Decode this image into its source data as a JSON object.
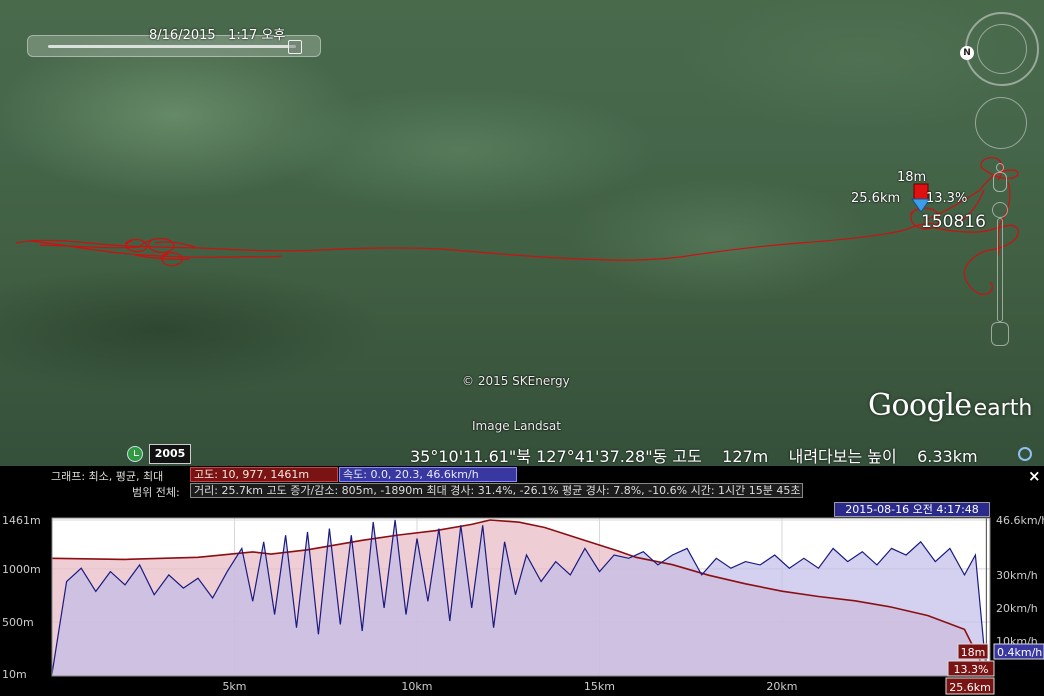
{
  "map": {
    "time_slider_label": "8/16/2015   1:17 오후",
    "tour_label": {
      "altitude": "18m",
      "distance": "25.6km",
      "grade": "13.3%",
      "name": "150816"
    },
    "north_button": "N",
    "copyright": "© 2015 SKEnergy",
    "imagery": "Image Landsat",
    "logo_google": "Google",
    "logo_earth": "earth",
    "track_color": "#cc1111"
  },
  "status_bar": {
    "history_year": "2005",
    "coordinates": "35°10'11.61\"북 127°41'37.28\"동 고도    127m    내려다보는 높이    6.33km"
  },
  "profile": {
    "row1_label": "그래프: 최소, 평균, 최대",
    "row2_label": "범위 전체:",
    "altitude_box": "고도: 10, 977, 1461m",
    "speed_box": "속도: 0.0, 20.3, 46.6km/h",
    "stats_box": "거리: 25.7km 고도 증가/감소: 805m, -1890m 최대 경사: 31.4%, -26.1%  평균 경사: 7.8%, -10.6%  시간: 1시간 15분 45초",
    "cursor_time": "2015-08-16 오전 4:17:48",
    "close_label": "×",
    "cursor_values": {
      "altitude": "18m",
      "grade": "13.3%",
      "distance": "25.6km",
      "speed": "0.4km/h"
    }
  },
  "chart_data": {
    "type": "line",
    "title": "",
    "xlabel": "",
    "ylabel": "",
    "x_range_km": [
      0,
      25.7
    ],
    "x_ticks": [
      {
        "value": 5,
        "label": "5km"
      },
      {
        "value": 10,
        "label": "10km"
      },
      {
        "value": 15,
        "label": "15km"
      },
      {
        "value": 20,
        "label": "20km"
      }
    ],
    "left_axis": {
      "range_m": [
        10,
        1461
      ],
      "ticks": [
        {
          "value": 1461,
          "label": "1461m"
        },
        {
          "value": 1000,
          "label": "1000m"
        },
        {
          "value": 500,
          "label": "500m"
        },
        {
          "value": 10,
          "label": "10m"
        }
      ]
    },
    "right_axis": {
      "range_kmh": [
        0,
        46.6
      ],
      "ticks": [
        {
          "value": 46.6,
          "label": "46.6km/h"
        },
        {
          "value": 30,
          "label": "30km/h"
        },
        {
          "value": 20,
          "label": "20km/h"
        },
        {
          "value": 10,
          "label": "10km/h"
        }
      ]
    },
    "grid": true,
    "series": [
      {
        "name": "고도",
        "color": "#8b0f12",
        "fill": "#e8bcc6",
        "x": [
          0,
          2,
          4,
          5.5,
          6,
          7,
          8.5,
          9.5,
          10.5,
          11.5,
          12,
          12.8,
          13.5,
          14.5,
          15.5,
          16,
          17,
          18,
          19,
          20,
          21,
          22,
          23,
          24,
          25,
          25.6
        ],
        "y": [
          1100,
          1090,
          1110,
          1160,
          1140,
          1180,
          1270,
          1320,
          1360,
          1420,
          1461,
          1440,
          1390,
          1280,
          1170,
          1110,
          1040,
          940,
          860,
          790,
          740,
          700,
          640,
          560,
          430,
          18
        ]
      },
      {
        "name": "속도",
        "color": "#1a1a80",
        "fill": "#c2bce8",
        "x": [
          0,
          0.4,
          0.8,
          1.2,
          1.6,
          2.0,
          2.4,
          2.8,
          3.2,
          3.6,
          4.0,
          4.4,
          4.8,
          5.2,
          5.5,
          5.8,
          6.1,
          6.4,
          6.7,
          7.0,
          7.3,
          7.6,
          7.9,
          8.2,
          8.5,
          8.8,
          9.1,
          9.4,
          9.7,
          10.0,
          10.3,
          10.6,
          10.9,
          11.2,
          11.5,
          11.8,
          12.1,
          12.4,
          12.7,
          13.0,
          13.4,
          13.8,
          14.2,
          14.6,
          15.0,
          15.4,
          15.8,
          16.2,
          16.6,
          17.0,
          17.4,
          17.8,
          18.2,
          18.6,
          19.0,
          19.4,
          19.8,
          20.2,
          20.6,
          21.0,
          21.4,
          21.8,
          22.2,
          22.6,
          23.0,
          23.4,
          23.8,
          24.2,
          24.6,
          25.0,
          25.3,
          25.6
        ],
        "y": [
          0,
          28,
          32,
          25,
          31,
          27,
          33,
          24,
          30,
          26,
          29,
          23,
          31,
          38,
          22,
          40,
          18,
          42,
          14,
          43,
          12,
          44,
          15,
          42,
          13,
          46,
          20,
          46.6,
          18,
          41,
          22,
          44,
          16,
          45,
          20,
          45,
          14,
          40,
          24,
          36,
          28,
          34,
          30,
          38,
          31,
          36,
          35,
          37,
          33,
          36,
          38,
          30,
          35,
          32,
          34,
          33,
          36,
          32,
          35,
          32,
          38,
          34,
          37,
          33,
          38,
          36,
          40,
          34,
          38,
          30,
          36,
          0.4
        ]
      }
    ],
    "cursor": {
      "x_km": 25.6,
      "altitude_m": 18,
      "grade_pct": 13.3,
      "speed_kmh": 0.4
    }
  }
}
